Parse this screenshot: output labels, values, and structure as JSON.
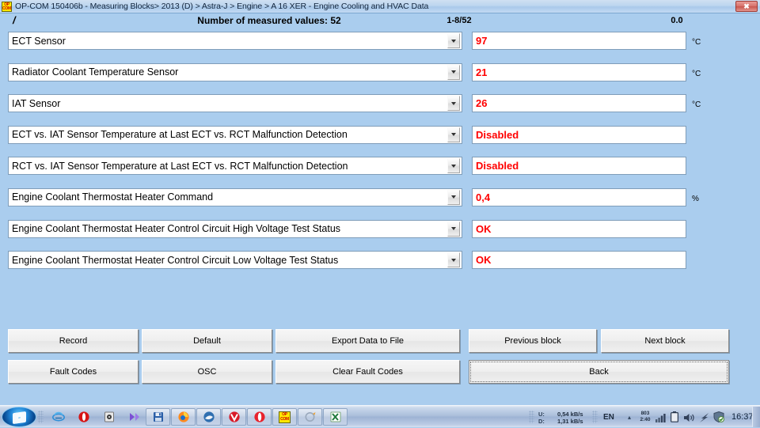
{
  "window": {
    "icon": "opcom-logo-icon",
    "title": "OP-COM 150406b - Measuring Blocks> 2013 (D) > Astra-J > Engine > A 16 XER - Engine Cooling and HVAC Data",
    "close_label": "✖"
  },
  "header": {
    "slash": "/",
    "title": "Number of measured values: 52",
    "range": "1-8/52",
    "value": "0.0"
  },
  "rows": [
    {
      "parameter": "ECT Sensor",
      "value": "97",
      "unit": "°C"
    },
    {
      "parameter": "Radiator Coolant Temperature Sensor",
      "value": "21",
      "unit": "°C"
    },
    {
      "parameter": "IAT Sensor",
      "value": "26",
      "unit": "°C"
    },
    {
      "parameter": "ECT vs. IAT Sensor Temperature at Last ECT vs. RCT Malfunction Detection",
      "value": "Disabled",
      "unit": ""
    },
    {
      "parameter": "RCT vs. IAT Sensor Temperature at Last ECT vs. RCT Malfunction Detection",
      "value": "Disabled",
      "unit": ""
    },
    {
      "parameter": "Engine Coolant Thermostat Heater Command",
      "value": "0,4",
      "unit": "%"
    },
    {
      "parameter": "Engine Coolant Thermostat Heater Control Circuit High Voltage Test Status",
      "value": "OK",
      "unit": ""
    },
    {
      "parameter": "Engine Coolant Thermostat Heater Control Circuit Low Voltage Test Status",
      "value": "OK",
      "unit": ""
    }
  ],
  "buttons": {
    "record": "Record",
    "default": "Default",
    "export_data_to_file": "Export Data to File",
    "previous_block": "Previous block",
    "next_block": "Next block",
    "fault_codes": "Fault Codes",
    "osc": "OSC",
    "clear_fault_codes": "Clear Fault Codes",
    "back": "Back"
  },
  "taskbar": {
    "start": "start-orb-icon",
    "pinned": [
      "internet-explorer-icon",
      "opera-red-icon",
      "media-player-icon",
      "windows-media-center-icon",
      "save-floppy-icon",
      "firefox-icon",
      "seamonkey-icon",
      "vivaldi-icon",
      "opera-icon",
      "opcom-icon",
      "dialup-icon",
      "excel-icon"
    ],
    "tray": {
      "net_up_label": "U:",
      "net_down_label": "D:",
      "net_up_value": "0,54 kB/s",
      "net_down_value": "1,31 kB/s",
      "language": "EN",
      "show_hidden": "▴",
      "uptime_top": "803",
      "uptime_bottom": "2:40",
      "icons": [
        "signal-bars-icon",
        "battery-icon",
        "volume-icon",
        "flash-icon",
        "security-shield-icon"
      ],
      "clock": "16:37"
    }
  },
  "colors": {
    "background": "#aacdee",
    "value_text": "#ff0000",
    "field_border": "#7f9db9"
  }
}
